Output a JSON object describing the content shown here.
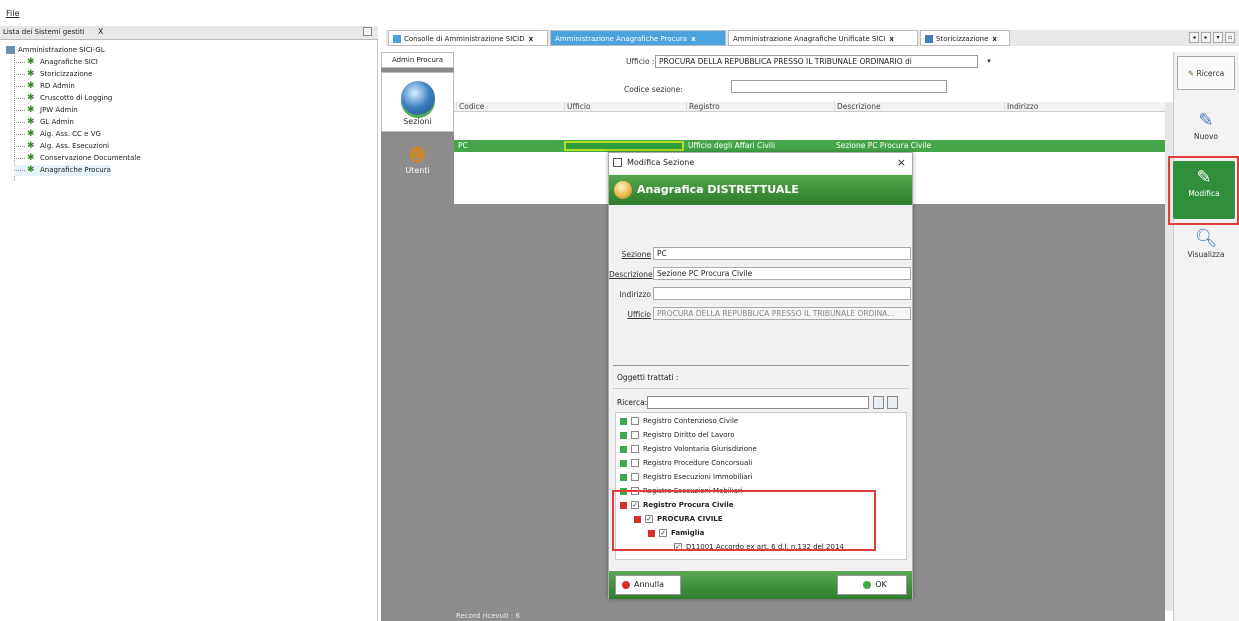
{
  "menu": {
    "file": "File"
  },
  "left_panel": {
    "title": "Lista dei Sistemi gestiti",
    "close": "X",
    "root": "Amministrazione SICI-GL",
    "items": [
      "Anagrafiche SICI",
      "Storicizzazione",
      "RD Admin",
      "Cruscotto di Logging",
      "JPW Admin",
      "GL Admin",
      "Alg. Ass. CC e VG",
      "Alg. Ass. Esecuzioni",
      "Conservazione Documentale",
      "Anagrafiche Procura"
    ]
  },
  "tabs": [
    {
      "label": "Consolle di Amministrazione SICID",
      "close": "x",
      "active": false
    },
    {
      "label": "Amministrazione Anagrafiche Procura",
      "close": "x",
      "active": true
    },
    {
      "label": "Amministrazione Anagrafiche Unificate SICI",
      "close": "x",
      "active": false
    },
    {
      "label": "Storicizzazione",
      "close": "x",
      "active": false
    }
  ],
  "nav": {
    "tab": "Admin Procura",
    "sezioni": "Sezioni",
    "utenti": "Utenti"
  },
  "filter": {
    "ufficio_label": "Ufficio :",
    "ufficio_value": "PROCURA DELLA REPUBBLICA PRESSO IL TRIBUNALE ORDINARIO di",
    "codice_label": "Codice sezione:",
    "codice_value": ""
  },
  "grid": {
    "columns": [
      "Codice",
      "Ufficio",
      "Registro",
      "Descrizione",
      "Indirizzo"
    ],
    "selected_row": {
      "codice": "PC",
      "ufficio": "",
      "registro": "Ufficio degli Affari Civili",
      "descrizione": "Sezione PC Procura Civile",
      "indirizzo": ""
    },
    "status": "Record ricevuti : 6"
  },
  "toolbar": {
    "ricerca": "Ricerca",
    "nuovo": "Nuovo",
    "modifica": "Modifica",
    "visualizza": "Visualizza"
  },
  "modal": {
    "title": "Modifica Sezione",
    "close": "×",
    "banner": "Anagrafica DISTRETTUALE",
    "fields": {
      "sezione_label": "Sezione",
      "sezione_value": "PC",
      "descrizione_label": "Descrizione",
      "descrizione_value": "Sezione PC Procura Civile",
      "indirizzo_label": "Indirizzo",
      "indirizzo_value": "",
      "ufficio_label": "Ufficio",
      "ufficio_value": "PROCURA DELLA REPUBBLICA PRESSO IL TRIBUNALE ORDINA..."
    },
    "oggetti_label": "Oggetti trattati :",
    "ricerca_label": "Ricerca:",
    "tree": [
      {
        "label": "Registro Contenzioso Civile",
        "checked": false,
        "expanded": false
      },
      {
        "label": "Registro Diritto del Lavoro",
        "checked": false,
        "expanded": false
      },
      {
        "label": "Registro Volontaria Giurisdizione",
        "checked": false,
        "expanded": false
      },
      {
        "label": "Registro Procedure Concorsuali",
        "checked": false,
        "expanded": false
      },
      {
        "label": "Registro Esecuzioni Immobiliari",
        "checked": false,
        "expanded": false
      },
      {
        "label": "Registro Esecuzioni Mobiliari",
        "checked": false,
        "expanded": false
      },
      {
        "label": "Registro Procura Civile",
        "checked": true,
        "expanded": true
      },
      {
        "label": "PROCURA CIVILE",
        "checked": true,
        "expanded": true
      },
      {
        "label": "Famiglia",
        "checked": true,
        "expanded": true
      },
      {
        "label": "D11001 Accordo ex art. 6 d.l. n.132 del 2014",
        "checked": true,
        "expanded": false
      }
    ],
    "annulla": "Annulla",
    "ok": "OK"
  }
}
